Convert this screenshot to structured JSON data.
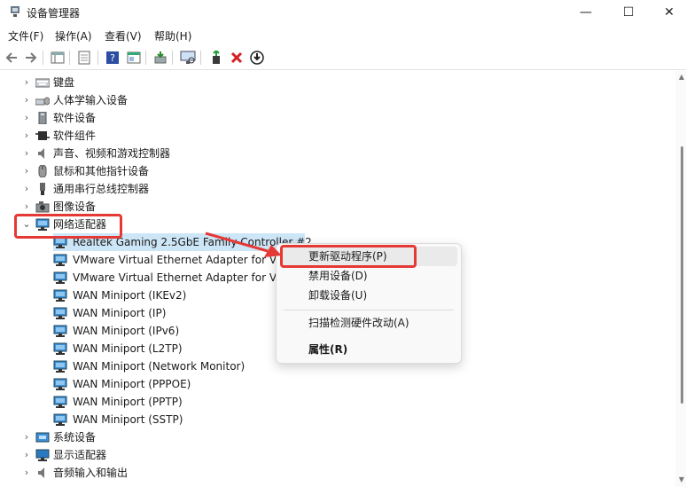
{
  "window": {
    "title": "设备管理器",
    "minimize": "—",
    "maximize": "☐",
    "close": "✕"
  },
  "menu": [
    "文件(F)",
    "操作(A)",
    "查看(V)",
    "帮助(H)"
  ],
  "tree": {
    "categories_top": [
      {
        "label": "键盘",
        "icon": "keyboard-icon"
      },
      {
        "label": "人体学输入设备",
        "icon": "hid-icon"
      },
      {
        "label": "软件设备",
        "icon": "software-device-icon"
      },
      {
        "label": "软件组件",
        "icon": "software-component-icon"
      },
      {
        "label": "声音、视频和游戏控制器",
        "icon": "speaker-icon"
      },
      {
        "label": "鼠标和其他指针设备",
        "icon": "mouse-icon"
      },
      {
        "label": "通用串行总线控制器",
        "icon": "usb-icon"
      },
      {
        "label": "图像设备",
        "icon": "camera-icon"
      }
    ],
    "expanded_category": {
      "label": "网络适配器",
      "icon": "network-adapter-icon"
    },
    "adapters": [
      "Realtek Gaming 2.5GbE Family Controller #2",
      "VMware Virtual Ethernet Adapter for VMnet1",
      "VMware Virtual Ethernet Adapter for VMnet8",
      "WAN Miniport (IKEv2)",
      "WAN Miniport (IP)",
      "WAN Miniport (IPv6)",
      "WAN Miniport (L2TP)",
      "WAN Miniport (Network Monitor)",
      "WAN Miniport (PPPOE)",
      "WAN Miniport (PPTP)",
      "WAN Miniport (SSTP)"
    ],
    "categories_bottom": [
      {
        "label": "系统设备",
        "icon": "system-device-icon"
      },
      {
        "label": "显示适配器",
        "icon": "display-adapter-icon"
      },
      {
        "label": "音频输入和输出",
        "icon": "audio-io-icon"
      }
    ]
  },
  "context_menu": {
    "update_driver": "更新驱动程序(P)",
    "disable_device": "禁用设备(D)",
    "uninstall_device": "卸载设备(U)",
    "scan_hardware": "扫描检测硬件改动(A)",
    "properties": "属性(R)"
  },
  "colors": {
    "highlight": "#e53935",
    "selection": "#cde6f7",
    "accent": "#0a64c8"
  }
}
